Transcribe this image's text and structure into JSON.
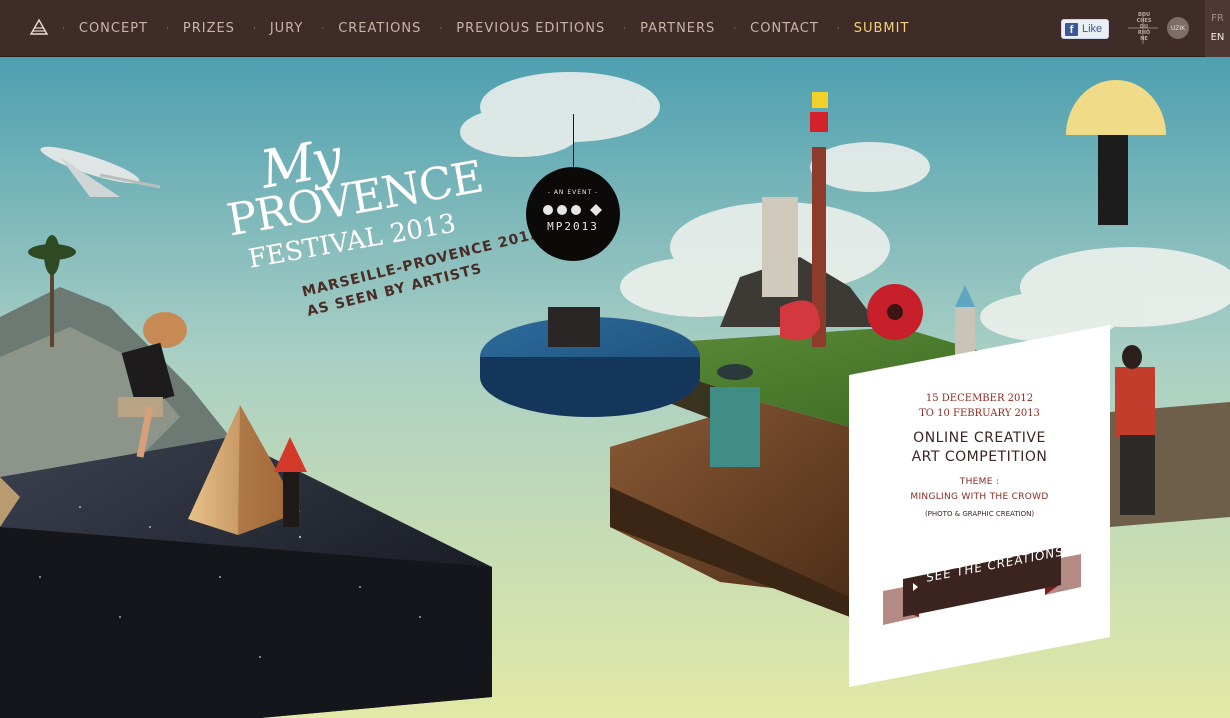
{
  "nav": {
    "home_icon": "pyramid-icon",
    "items": [
      {
        "label": "CONCEPT"
      },
      {
        "label": "PRIZES"
      },
      {
        "label": "JURY"
      },
      {
        "label": "CREATIONS"
      },
      {
        "label": "PREVIOUS EDITIONS"
      },
      {
        "label": "PARTNERS"
      },
      {
        "label": "CONTACT"
      },
      {
        "label": "SUBMIT"
      }
    ],
    "separator": "·",
    "facebook": {
      "label": "Like",
      "glyph": "f"
    },
    "partner_logo_text": [
      "BOU",
      "CHES",
      "DU",
      "RHÔ",
      "NE"
    ],
    "partner_badge": "UZIK",
    "languages": [
      "FR",
      "EN"
    ],
    "active_language": "EN"
  },
  "hero": {
    "title_my": "My",
    "title_provence": "PROVENCE",
    "title_festival": "FESTIVAL 2013",
    "tagline_1": "MARSEILLE-PROVENCE 2013",
    "tagline_2": "AS SEEN BY ARTISTS",
    "badge_event": "- AN EVENT -",
    "badge_code": "MP2013"
  },
  "card": {
    "date_from": "15 DECEMBER 2012",
    "date_to": "TO 10 FEBRUARY 2013",
    "title_1": "ONLINE CREATIVE",
    "title_2": "ART COMPETITION",
    "theme_label": "THEME :",
    "theme_value": "MINGLING WITH THE CROWD",
    "subtitle": "(PHOTO & GRAPHIC CREATION)",
    "cta_label": "SEE THE CREATIONS"
  },
  "colors": {
    "nav_bg": "#3f2b27",
    "nav_text": "#c9b4aa",
    "submit": "#f4d27a",
    "sky_top": "#4d9fb0",
    "sky_bottom": "#e3e9a6",
    "accent_red": "#8b2a22"
  }
}
